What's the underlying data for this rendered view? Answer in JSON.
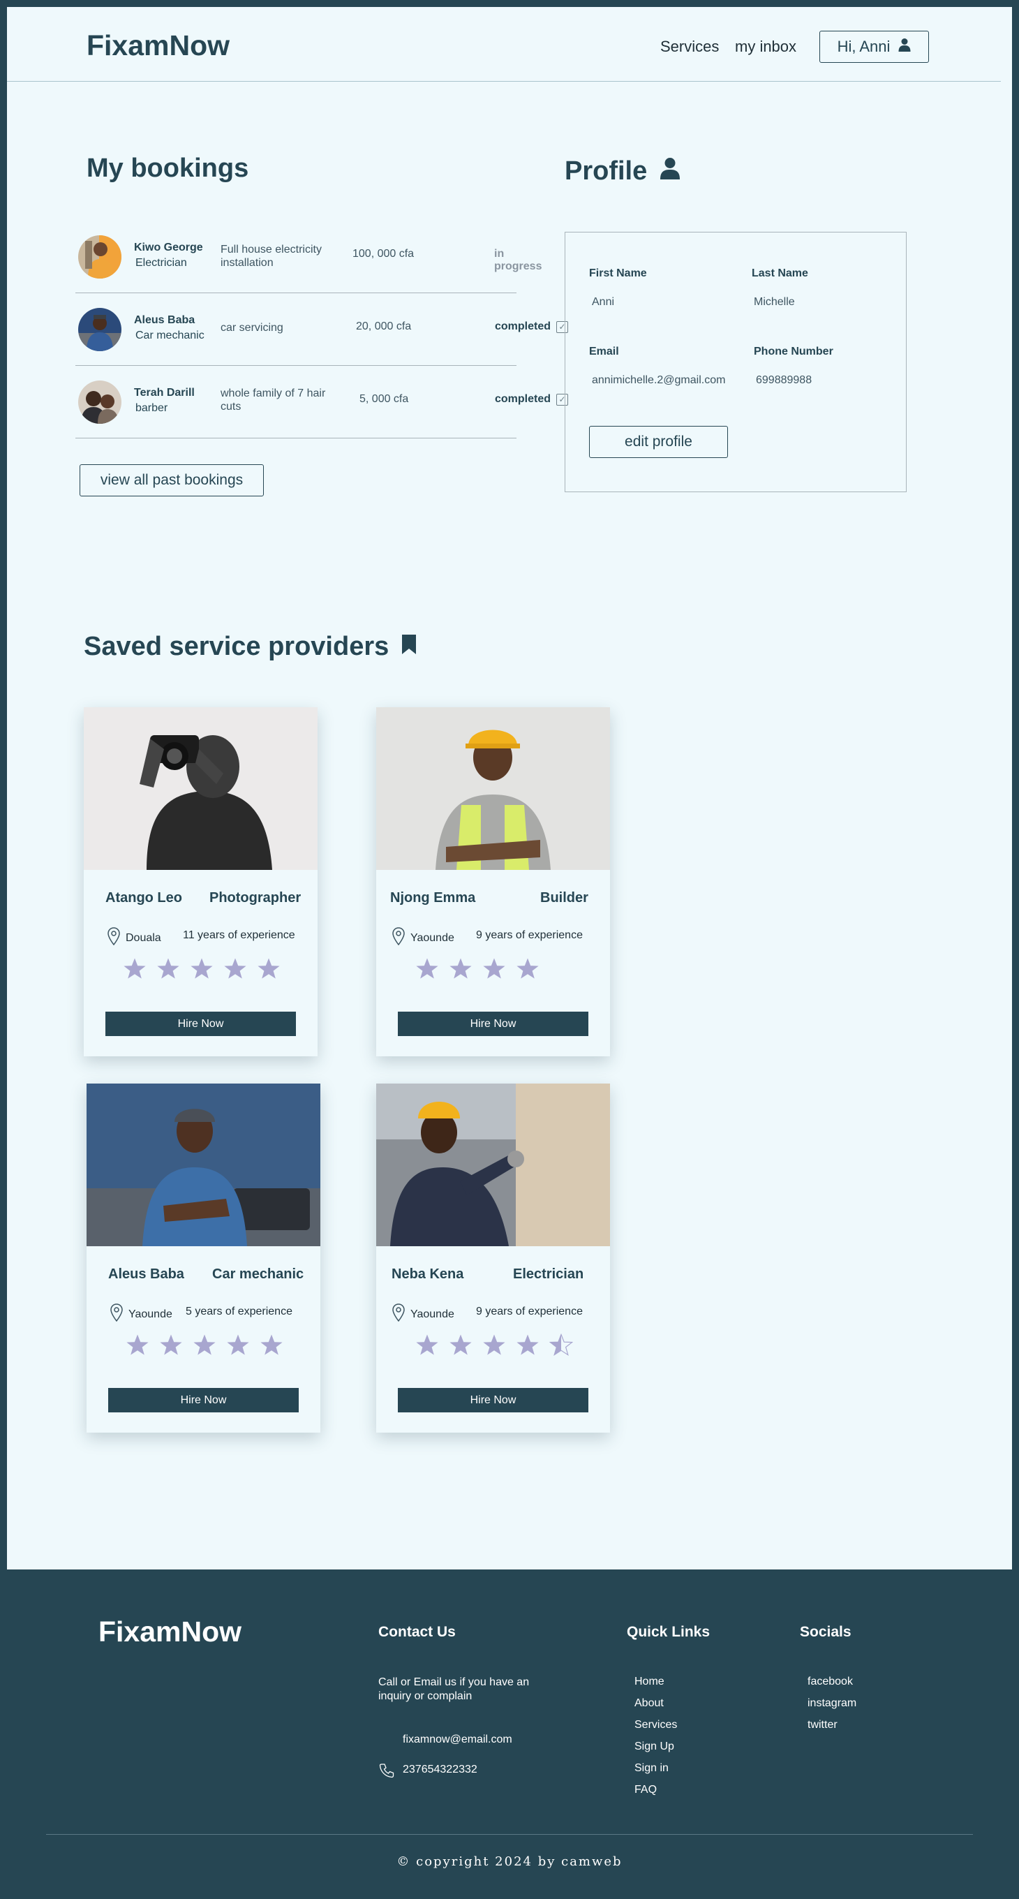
{
  "header": {
    "logo": "FixamNow",
    "nav": [
      "Services",
      "my inbox"
    ],
    "user_button": "Hi, Anni"
  },
  "bookings": {
    "title": "My bookings",
    "rows": [
      {
        "name": "Kiwo George",
        "role": "Electrician",
        "description": "Full house electricity installation",
        "price": "100, 000 cfa",
        "status": "in progress"
      },
      {
        "name": "Aleus Baba",
        "role": "Car mechanic",
        "description": "car servicing",
        "price": "20, 000 cfa",
        "status": "completed"
      },
      {
        "name": "Terah Darill",
        "role": "barber",
        "description": "whole family of 7 hair cuts",
        "price": "5, 000 cfa",
        "status": "completed"
      }
    ],
    "view_all_label": "view  all past bookings"
  },
  "profile": {
    "title": "Profile",
    "first_name_label": "First Name",
    "first_name": "Anni",
    "last_name_label": "Last Name",
    "last_name": "Michelle",
    "email_label": "Email",
    "email": "annimichelle.2@gmail.com",
    "phone_label": "Phone Number",
    "phone": "699889988",
    "edit_label": "edit profile"
  },
  "saved": {
    "title": "Saved  service providers",
    "providers": [
      {
        "name": "Atango Leo",
        "profession": "Photographer",
        "location": "Douala",
        "experience": "11 years of experience",
        "rating": 5,
        "hire_label": "Hire Now"
      },
      {
        "name": "Njong Emma",
        "profession": "Builder",
        "location": "Yaounde",
        "experience": "9 years of experience",
        "rating": 4,
        "hire_label": "Hire Now"
      },
      {
        "name": "Aleus Baba",
        "profession": "Car mechanic",
        "location": "Yaounde",
        "experience": "5 years of experience",
        "rating": 5,
        "hire_label": "Hire Now"
      },
      {
        "name": "Neba Kena",
        "profession": "Electrician",
        "location": "Yaounde",
        "experience": "9 years of experience",
        "rating": 4.5,
        "hire_label": "Hire Now"
      }
    ],
    "star_color": "#a8a6cf"
  },
  "footer": {
    "logo": "FixamNow",
    "contact": {
      "title": "Contact Us",
      "text": "Call or Email us if you have an inquiry or complain",
      "email": "fixamnow@email.com",
      "phone": "237654322332"
    },
    "quick_links": {
      "title": "Quick Links",
      "items": [
        "Home",
        "About",
        "Services",
        "Sign Up",
        "Sign in",
        "FAQ"
      ]
    },
    "socials": {
      "title": "Socials",
      "items": [
        "facebook",
        "instagram",
        "twitter"
      ]
    },
    "copyright": "© copyright 2024 by camweb"
  },
  "colors": {
    "primary": "#264653",
    "background": "#eff9fc",
    "star": "#a8a6cf"
  }
}
